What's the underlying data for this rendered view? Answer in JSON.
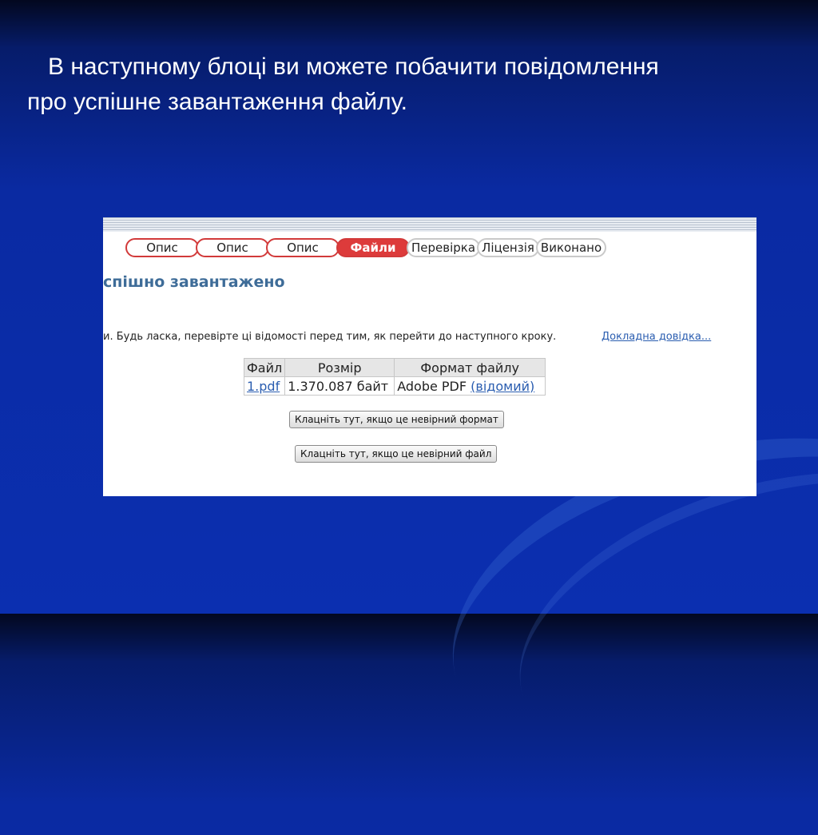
{
  "slide": {
    "line1": "В наступному блоці ви можете побачити повідомлення",
    "line2": "про успішне завантаження файлу."
  },
  "upload_page": {
    "steps": [
      {
        "label": "Опис",
        "state": "done"
      },
      {
        "label": "Опис",
        "state": "done"
      },
      {
        "label": "Опис",
        "state": "done"
      },
      {
        "label": "Файли",
        "state": "active"
      },
      {
        "label": "Перевірка",
        "state": "todo"
      },
      {
        "label": "Ліцензія",
        "state": "todo"
      },
      {
        "label": "Виконано",
        "state": "todo"
      }
    ],
    "heading": "спішно завантажено",
    "instruction": "и. Будь ласка, перевірте ці відомості перед тим, як перейти до наступного кроку.",
    "help_link": "Докладна довідка...",
    "table": {
      "headers": [
        "Файл",
        "Розмір",
        "Формат файлу"
      ],
      "rows": [
        {
          "file": "1.pdf",
          "size": "1.370.087 байт",
          "format": "Adobe PDF",
          "format_status": "(відомий)"
        }
      ]
    },
    "buttons": {
      "wrong_format": "Клацніть тут, якщо це невірний формат",
      "wrong_file": "Клацніть тут, якщо це невірний файл"
    }
  },
  "colors": {
    "active_step": "#dd3b3b",
    "link": "#2a5db0",
    "heading": "#3e6c98"
  }
}
